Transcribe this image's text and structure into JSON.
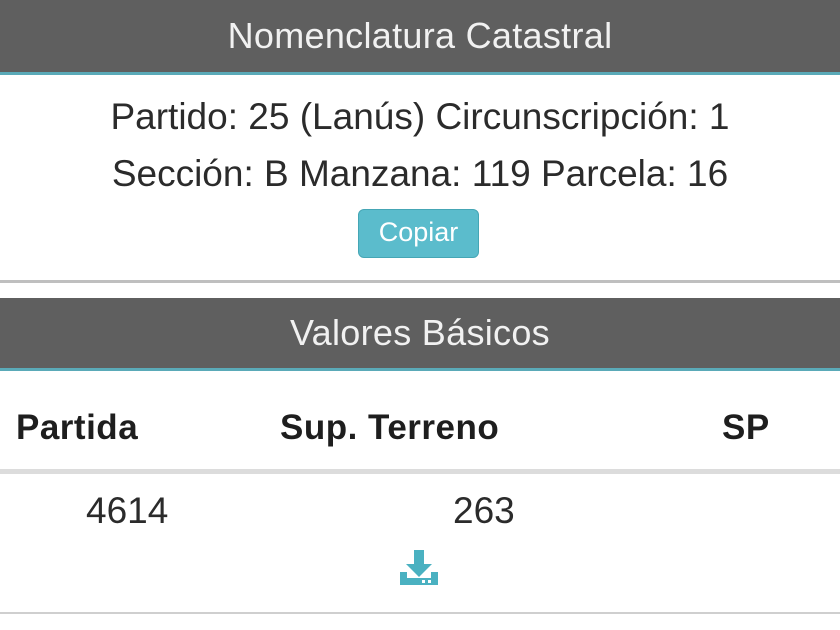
{
  "nomenclatura": {
    "title": "Nomenclatura Catastral",
    "line1": "Partido: 25 (Lanús) Circunscripción: 1",
    "line2": "Sección: B Manzana: 119 Parcela: 16",
    "copy_label": "Copiar"
  },
  "valores": {
    "title": "Valores Básicos",
    "columns": [
      "Partida",
      "Sup. Terreno",
      "SP"
    ],
    "rows": [
      [
        "4614",
        "263",
        ""
      ]
    ],
    "download_icon": "download-icon"
  },
  "colors": {
    "header_bg": "#5f5f5f",
    "accent": "#5bbccc"
  }
}
